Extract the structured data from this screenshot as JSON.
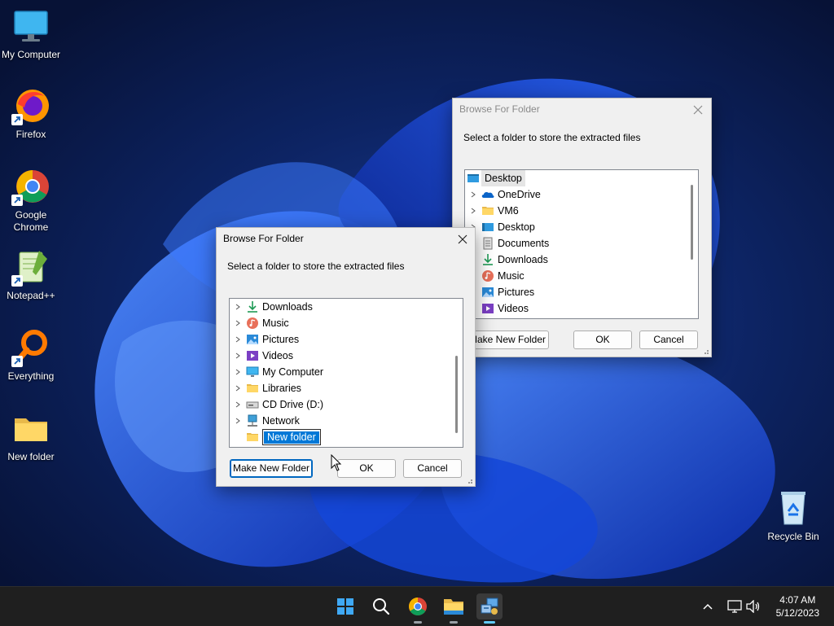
{
  "desktop": {
    "icons": [
      {
        "label": "My Computer",
        "icon": "monitor-icon"
      },
      {
        "label": "Firefox",
        "icon": "firefox-icon"
      },
      {
        "label": "Google Chrome",
        "icon": "chrome-icon"
      },
      {
        "label": "Notepad++",
        "icon": "notepadpp-icon"
      },
      {
        "label": "Everything",
        "icon": "everything-search-icon"
      },
      {
        "label": "New folder",
        "icon": "folder-icon"
      },
      {
        "label": "Recycle Bin",
        "icon": "recycle-bin-icon"
      }
    ]
  },
  "dialog_back": {
    "title": "Browse For Folder",
    "prompt": "Select a folder to store the extracted files",
    "root": "Desktop",
    "items": [
      {
        "label": "OneDrive",
        "icon": "onedrive-icon"
      },
      {
        "label": "VM6",
        "icon": "folder-icon"
      },
      {
        "label": "Desktop",
        "icon": "desktop-icon"
      },
      {
        "label": "Documents",
        "icon": "documents-icon"
      },
      {
        "label": "Downloads",
        "icon": "downloads-icon"
      },
      {
        "label": "Music",
        "icon": "music-icon"
      },
      {
        "label": "Pictures",
        "icon": "pictures-icon"
      },
      {
        "label": "Videos",
        "icon": "videos-icon"
      }
    ],
    "buttons": {
      "make_new_folder": "Make New Folder",
      "ok": "OK",
      "cancel": "Cancel"
    }
  },
  "dialog_front": {
    "title": "Browse For Folder",
    "prompt": "Select a folder to store the extracted files",
    "items": [
      {
        "label": "Downloads",
        "icon": "downloads-icon"
      },
      {
        "label": "Music",
        "icon": "music-icon"
      },
      {
        "label": "Pictures",
        "icon": "pictures-icon"
      },
      {
        "label": "Videos",
        "icon": "videos-icon"
      },
      {
        "label": "My Computer",
        "icon": "monitor-icon"
      },
      {
        "label": "Libraries",
        "icon": "libraries-icon"
      },
      {
        "label": "CD Drive (D:)",
        "icon": "cd-drive-icon"
      },
      {
        "label": "Network",
        "icon": "network-icon"
      }
    ],
    "new_folder_edit": "New folder",
    "buttons": {
      "make_new_folder": "Make New Folder",
      "ok": "OK",
      "cancel": "Cancel"
    }
  },
  "taskbar": {
    "items": [
      "start-icon",
      "search-icon",
      "chrome-icon",
      "file-explorer-icon",
      "installer-app-icon"
    ],
    "tray": [
      "chevron-up-icon",
      "network-icon",
      "volume-icon"
    ],
    "time": "4:07 AM",
    "date": "5/12/2023"
  }
}
